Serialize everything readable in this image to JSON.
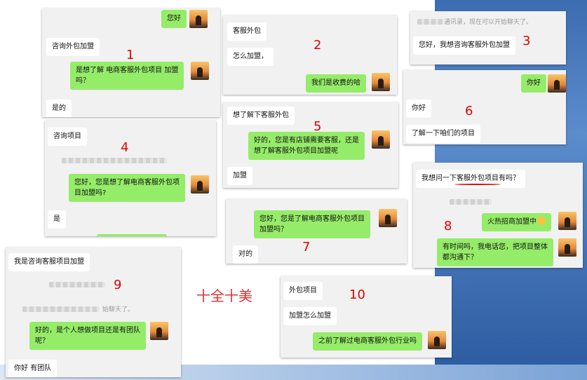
{
  "slogan": "十全十美",
  "panels": {
    "p1": {
      "number": "1",
      "greet": "您好",
      "q": "咨询外包加盟",
      "ask1": "是想了解 电商客服外包项目 加盟",
      "ask2": "吗？",
      "ans": "是的"
    },
    "p2": {
      "number": "2",
      "a": "客服外包",
      "b": "怎么加盟，",
      "reply": "我们是收费的哈"
    },
    "p3": {
      "number": "3",
      "note": "通讯录，现在可以开始聊天了。",
      "q": "您好，我想咨询客服外包加盟"
    },
    "p4": {
      "number": "4",
      "q": "咨询项目",
      "reply1": "您好，您是想了解电商客服外包项",
      "reply2": "目加盟吗?",
      "ans": "是"
    },
    "p5": {
      "number": "5",
      "q": "想了解下客服外包",
      "reply1": "好的，您是有店铺需要客服，还是",
      "reply2": "想了解客服外包项目加盟呢",
      "ans": "加盟"
    },
    "p6": {
      "number": "6",
      "greet": "你好",
      "a": "你好",
      "b": "了解一下咱们的项目"
    },
    "p7": {
      "number": "7",
      "reply1": "您好，您是了解电商客服外包项目",
      "reply2": "加盟吗？",
      "ans": "对的"
    },
    "p8": {
      "number": "8",
      "q": "我想问一下客服外包项目有吗？",
      "r1": "火热招商加盟中",
      "r2a": "有时间吗，我电话您，把项目整体",
      "r2b": "都沟通下？"
    },
    "p9": {
      "number": "9",
      "q": "我是咨询客服项目加盟",
      "note": "始聊天了。",
      "reply1": "好的，是个人想做项目还是有团队",
      "reply2": "呢？",
      "ans": "你好 有团队"
    },
    "p10": {
      "number": "10",
      "a": "外包项目",
      "b": "加盟怎么加盟",
      "reply": "之前了解过电商客服外包行业吗"
    }
  }
}
